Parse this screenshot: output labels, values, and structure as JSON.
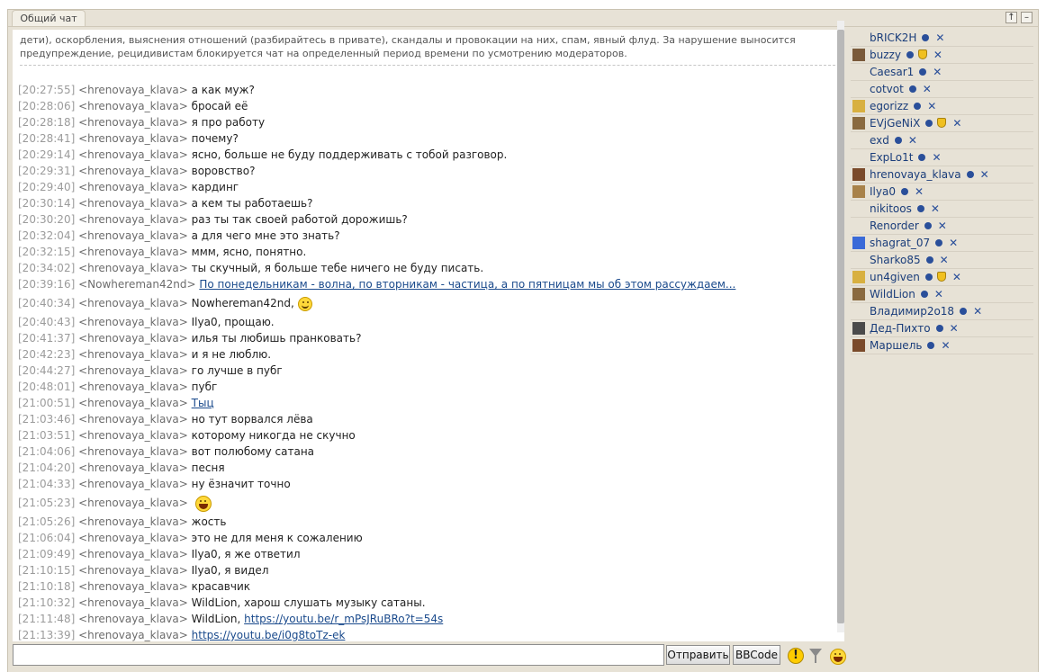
{
  "window": {
    "tab_title": "Общий чат",
    "up_button": "↑",
    "minimize_button": "–"
  },
  "rules_text": "дети), оскорбления, выяснения отношений (разбирайтесь в привате), скандалы и провокации на них, спам, явный флуд. За нарушение выносится предупреждение, рецидивистам блокируется чат на определенный период времени по усмотрению модераторов.",
  "messages": [
    {
      "time": "[20:27:55]",
      "nick": "<hrenovaya_klava>",
      "text": "а как муж?"
    },
    {
      "time": "[20:28:06]",
      "nick": "<hrenovaya_klava>",
      "text": "бросай её"
    },
    {
      "time": "[20:28:18]",
      "nick": "<hrenovaya_klava>",
      "text": "я про работу"
    },
    {
      "time": "[20:28:41]",
      "nick": "<hrenovaya_klava>",
      "text": "почему?"
    },
    {
      "time": "[20:29:14]",
      "nick": "<hrenovaya_klava>",
      "text": "ясно, больше не буду поддерживать с тобой разговор."
    },
    {
      "time": "[20:29:31]",
      "nick": "<hrenovaya_klava>",
      "text": "воровство?"
    },
    {
      "time": "[20:29:40]",
      "nick": "<hrenovaya_klava>",
      "text": "кардинг"
    },
    {
      "time": "[20:30:14]",
      "nick": "<hrenovaya_klava>",
      "text": "а кем ты работаешь?"
    },
    {
      "time": "[20:30:20]",
      "nick": "<hrenovaya_klava>",
      "text": "раз ты так своей работой дорожишь?"
    },
    {
      "time": "[20:32:04]",
      "nick": "<hrenovaya_klava>",
      "text": "а для чего мне это знать?"
    },
    {
      "time": "[20:32:15]",
      "nick": "<hrenovaya_klava>",
      "text": "ммм, ясно, понятно."
    },
    {
      "time": "[20:34:02]",
      "nick": "<hrenovaya_klava>",
      "text": "ты скучный, я больше тебе ничего не буду писать."
    },
    {
      "time": "[20:39:16]",
      "nick": "<Nowhereman42nd>",
      "text": "По понедельникам - волна, по вторникам - частица, а по пятницам мы об этом рассуждаем..."
    },
    {
      "time": "[20:40:34]",
      "nick": "<hrenovaya_klava>",
      "text": "Nowhereman42nd,"
    },
    {
      "time": "[20:40:43]",
      "nick": "<hrenovaya_klava>",
      "text": "Ilya0, прощаю."
    },
    {
      "time": "[20:41:37]",
      "nick": "<hrenovaya_klava>",
      "text": "илья ты любишь пранковать?"
    },
    {
      "time": "[20:42:23]",
      "nick": "<hrenovaya_klava>",
      "text": "и я не люблю."
    },
    {
      "time": "[20:44:27]",
      "nick": "<hrenovaya_klava>",
      "text": "го лучше в пубг"
    },
    {
      "time": "[20:48:01]",
      "nick": "<hrenovaya_klava>",
      "text": "пубг"
    },
    {
      "time": "[21:00:51]",
      "nick": "<hrenovaya_klava>",
      "text": "Тыц"
    },
    {
      "time": "[21:03:46]",
      "nick": "<hrenovaya_klava>",
      "text": "но тут ворвался лёва"
    },
    {
      "time": "[21:03:51]",
      "nick": "<hrenovaya_klava>",
      "text": "которому никогда не скучно"
    },
    {
      "time": "[21:04:06]",
      "nick": "<hrenovaya_klava>",
      "text": "вот полюбому сатана"
    },
    {
      "time": "[21:04:20]",
      "nick": "<hrenovaya_klava>",
      "text": "песня"
    },
    {
      "time": "[21:04:33]",
      "nick": "<hrenovaya_klava>",
      "text": "ну ёзначит точно"
    },
    {
      "time": "[21:05:23]",
      "nick": "<hrenovaya_klava>",
      "text": ""
    },
    {
      "time": "[21:05:26]",
      "nick": "<hrenovaya_klava>",
      "text": "жость"
    },
    {
      "time": "[21:06:04]",
      "nick": "<hrenovaya_klava>",
      "text": "это не для меня к сожалению"
    },
    {
      "time": "[21:09:49]",
      "nick": "<hrenovaya_klava>",
      "text": "Ilya0, я же ответил"
    },
    {
      "time": "[21:10:15]",
      "nick": "<hrenovaya_klava>",
      "text": "Ilya0, я видел"
    },
    {
      "time": "[21:10:18]",
      "nick": "<hrenovaya_klava>",
      "text": "красавчик"
    },
    {
      "time": "[21:10:32]",
      "nick": "<hrenovaya_klava>",
      "text": "WildLion, харош слушать музыку сатаны."
    },
    {
      "time": "[21:11:48]",
      "nick": "<hrenovaya_klava>",
      "text": "WildLion,",
      "link": "https://youtu.be/r_mPsJRuBRo?t=54s"
    },
    {
      "time": "[21:13:39]",
      "nick": "<hrenovaya_klava>",
      "text": "https://youtu.be/i0g8toTz-ek"
    }
  ],
  "input": {
    "value": "",
    "send_label": "Отправить",
    "bbcode_label": "BBCode",
    "warn_glyph": "!"
  },
  "users": [
    {
      "name": "bRICK2H",
      "avatar": false
    },
    {
      "name": "buzzy",
      "avatar": true,
      "shield": true
    },
    {
      "name": "Caesar1",
      "avatar": false
    },
    {
      "name": "cotvot",
      "avatar": false
    },
    {
      "name": "egorizz",
      "avatar": true
    },
    {
      "name": "EVjGeNiX",
      "avatar": true,
      "shield": true
    },
    {
      "name": "exd",
      "avatar": false
    },
    {
      "name": "ExpLo1t",
      "avatar": false
    },
    {
      "name": "hrenovaya_klava",
      "avatar": true
    },
    {
      "name": "Ilya0",
      "avatar": true
    },
    {
      "name": "nikitoos",
      "avatar": false
    },
    {
      "name": "Renorder",
      "avatar": false
    },
    {
      "name": "shagrat_07",
      "avatar": true
    },
    {
      "name": "Sharko85",
      "avatar": false
    },
    {
      "name": "un4given",
      "avatar": true,
      "shield": true
    },
    {
      "name": "WildLion",
      "avatar": true
    },
    {
      "name": "Владимир2o18",
      "avatar": false
    },
    {
      "name": "Дед-Пихто",
      "avatar": true
    },
    {
      "name": "Маршель",
      "avatar": true
    }
  ],
  "user_close_glyph": "✕",
  "colors": {
    "link": "#1a4a8c",
    "timestamp": "#9b9b9b",
    "panel_bg": "#e7e2d6"
  }
}
